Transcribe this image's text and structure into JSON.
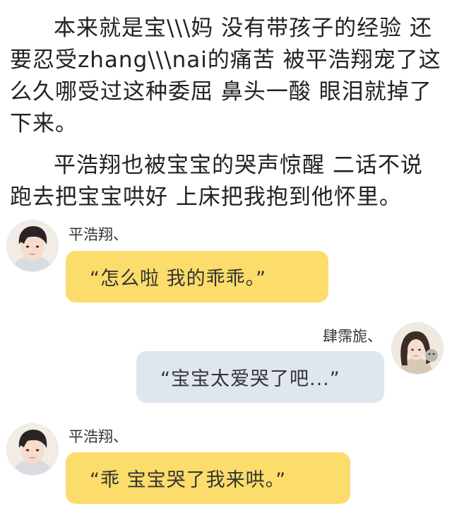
{
  "story": {
    "paragraph_1": "本来就是宝\\\\\\妈 没有带孩子的经验 还要忍受zhang\\\\\\nai的痛苦 被平浩翔宠了这么久哪受过这种委屈 鼻头一酸 眼泪就掉了下来。",
    "paragraph_2": "平浩翔也被宝宝的哭声惊醒 二话不说跑去把宝宝哄好 上床把我抱到他怀里。"
  },
  "chat": {
    "message_1": {
      "sender": "平浩翔、",
      "text": "“怎么啦 我的乖乖。”"
    },
    "message_2": {
      "sender": "肆霈旎、",
      "text": "“宝宝太爱哭了吧...”"
    },
    "message_3": {
      "sender": "平浩翔、",
      "text": "“乖 宝宝哭了我来哄。”"
    }
  },
  "colors": {
    "left_bubble": "#fcdc6b",
    "right_bubble": "#dfe6ee",
    "text": "#222222"
  }
}
